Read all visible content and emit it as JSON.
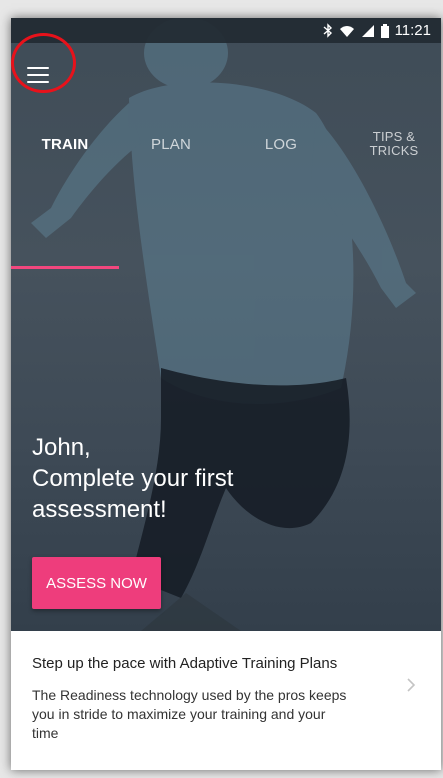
{
  "status_bar": {
    "time": "11:21",
    "icons": [
      "bluetooth-icon",
      "wifi-icon",
      "signal-icon",
      "battery-icon"
    ]
  },
  "app_bar": {
    "menu_icon": "hamburger-menu-icon"
  },
  "tabs": [
    {
      "label": "TRAIN",
      "selected": true
    },
    {
      "label": "PLAN",
      "selected": false
    },
    {
      "label": "LOG",
      "selected": false
    },
    {
      "label_line1": "TIPS &",
      "label_line2": "TRICKS",
      "selected": false
    }
  ],
  "hero": {
    "greeting_name": "John,",
    "message_line1": "Complete your first",
    "message_line2": "assessment!",
    "button_label": "ASSESS NOW"
  },
  "promo": {
    "title": "Step up the pace with Adaptive Training Plans",
    "body": "The Readiness technology used by the pros keeps you in stride to maximize your training and your time",
    "chevron_icon": "chevron-right-icon"
  },
  "colors": {
    "accent": "#ee3d7c",
    "tab_indicator": "#f2477e",
    "annotation_ring": "#e8121b",
    "hero_background": "#3f4c57"
  }
}
